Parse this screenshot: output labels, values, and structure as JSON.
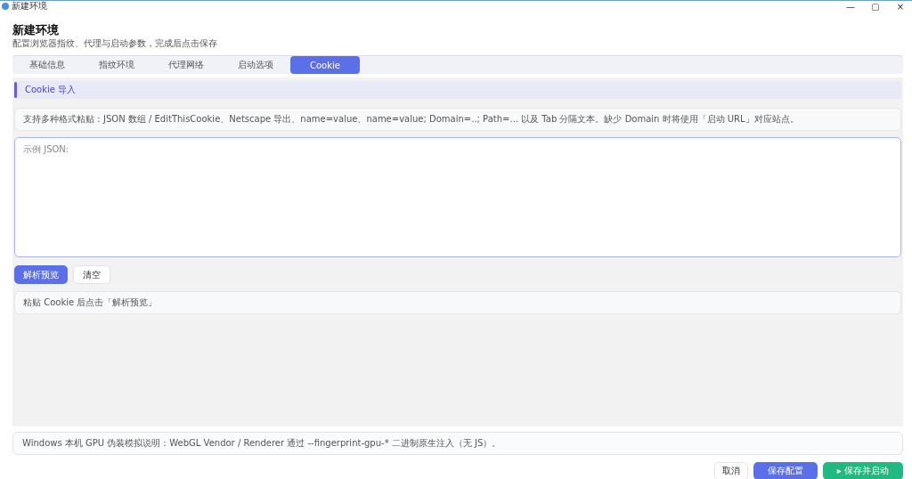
{
  "window": {
    "title": "新建环境",
    "controls": [
      "—",
      "▢",
      "×"
    ]
  },
  "header": {
    "title": "新建环境",
    "subtitle": "配置浏览器指纹、代理与启动参数，完成后点击保存"
  },
  "tabs": [
    {
      "label": "基础信息",
      "selected": false
    },
    {
      "label": "指纹环境",
      "selected": false
    },
    {
      "label": "代理网络",
      "selected": false
    },
    {
      "label": "启动选项",
      "selected": false
    },
    {
      "label": "Cookie",
      "selected": true
    }
  ],
  "section": {
    "title": "Cookie 导入"
  },
  "info": "支持多种格式粘贴：JSON 数组 / EditThisCookie、Netscape 导出、name=value、name=value; Domain=..; Path=... 以及 Tab 分隔文本。缺少 Domain 时将使用「启动 URL」对应站点。",
  "cookie_input": {
    "placeholder": "示例 JSON:"
  },
  "actions": [
    {
      "label": "解析预览",
      "kind": "primary"
    },
    {
      "label": "清空",
      "kind": "plain"
    }
  ],
  "status": "粘贴 Cookie 后点击「解析预览」",
  "note": "Windows 本机 GPU 伪装模拟说明：WebGL Vendor / Renderer 通过 --fingerprint-gpu-* 二进制原生注入（无 JS）。",
  "footer_buttons": [
    {
      "label": "取消",
      "kind": "plain"
    },
    {
      "label": "保存配置",
      "kind": "primary"
    },
    {
      "label": "▸ 保存并启动",
      "kind": "success"
    }
  ]
}
